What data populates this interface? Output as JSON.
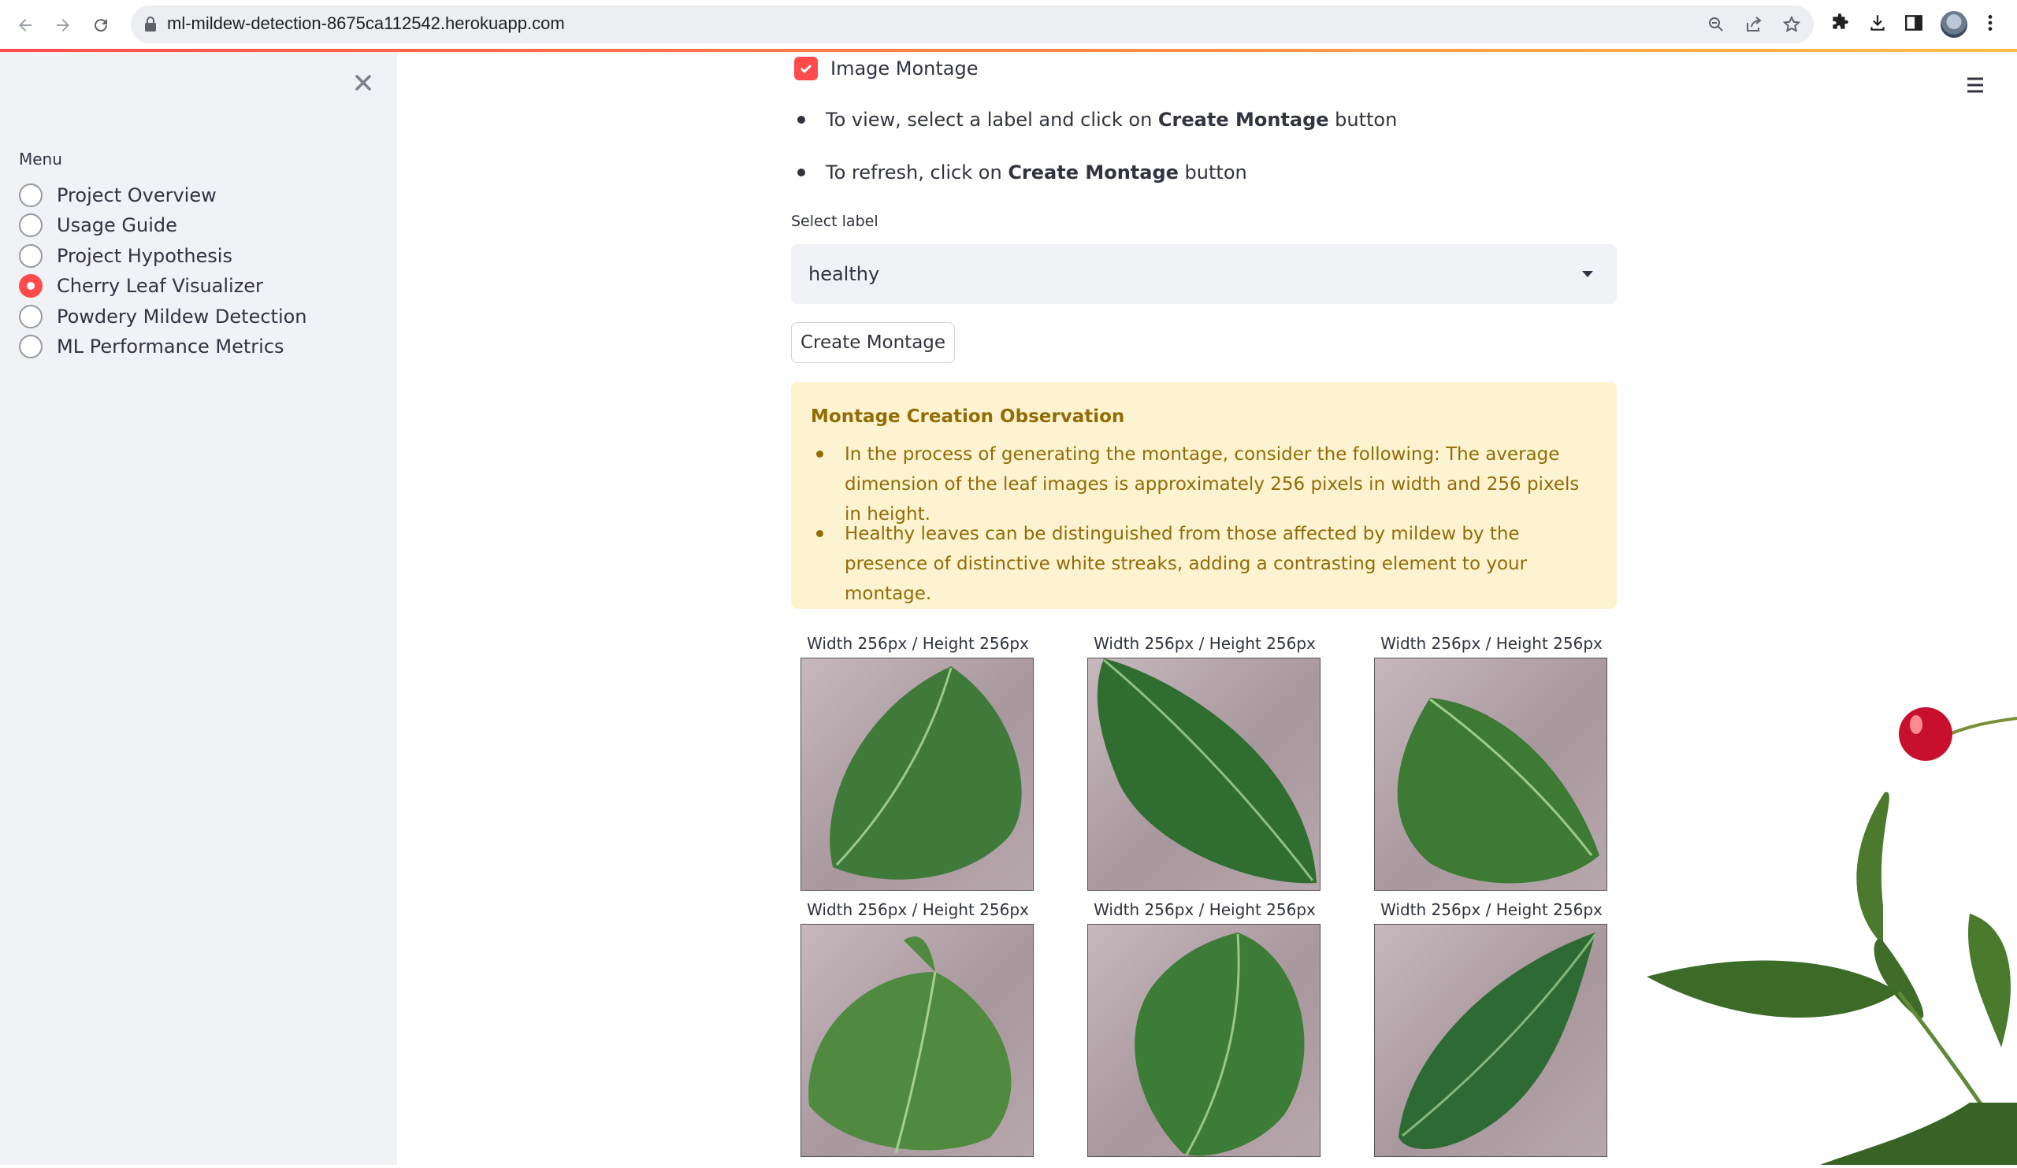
{
  "browser": {
    "url": "ml-mildew-detection-8675ca112542.herokuapp.com"
  },
  "sidebar": {
    "menu_label": "Menu",
    "items": [
      {
        "label": "Project Overview",
        "selected": false
      },
      {
        "label": "Usage Guide",
        "selected": false
      },
      {
        "label": "Project Hypothesis",
        "selected": false
      },
      {
        "label": "Cherry Leaf Visualizer",
        "selected": true
      },
      {
        "label": "Powdery Mildew Detection",
        "selected": false
      },
      {
        "label": "ML Performance Metrics",
        "selected": false
      }
    ]
  },
  "main": {
    "checkbox_label": "Image Montage",
    "instructions": [
      {
        "pre": "To view, select a label and click on ",
        "bold": "Create Montage",
        "post": " button"
      },
      {
        "pre": "To refresh, click on ",
        "bold": "Create Montage",
        "post": " button"
      }
    ],
    "select": {
      "label": "Select label",
      "value": "healthy"
    },
    "button_label": "Create Montage",
    "alert": {
      "title": "Montage Creation Observation",
      "items": [
        "In the process of generating the montage, consider the following: The average dimension of the leaf images is approximately 256 pixels in width and 256 pixels in height.",
        "Healthy leaves can be distinguished from those affected by mildew by the presence of distinctive white streaks, adding a contrasting element to your montage."
      ]
    },
    "montage": [
      {
        "caption": "Width 256px / Height 256px"
      },
      {
        "caption": "Width 256px / Height 256px"
      },
      {
        "caption": "Width 256px / Height 256px"
      },
      {
        "caption": "Width 256px / Height 256px"
      },
      {
        "caption": "Width 256px / Height 256px"
      },
      {
        "caption": "Width 256px / Height 256px"
      }
    ]
  },
  "colors": {
    "accent": "#ff4b4b",
    "sidebar_bg": "#f0f2f6",
    "alert_bg": "#fdf3d0",
    "alert_text": "#926c05"
  },
  "icons": [
    "back-arrow-icon",
    "forward-arrow-icon",
    "reload-icon",
    "lock-icon",
    "zoom-icon",
    "share-icon",
    "star-icon",
    "puzzle-icon",
    "download-icon",
    "side-panel-icon",
    "kebab-menu-icon",
    "close-icon",
    "hamburger-menu-icon",
    "check-icon",
    "chevron-down-icon"
  ]
}
